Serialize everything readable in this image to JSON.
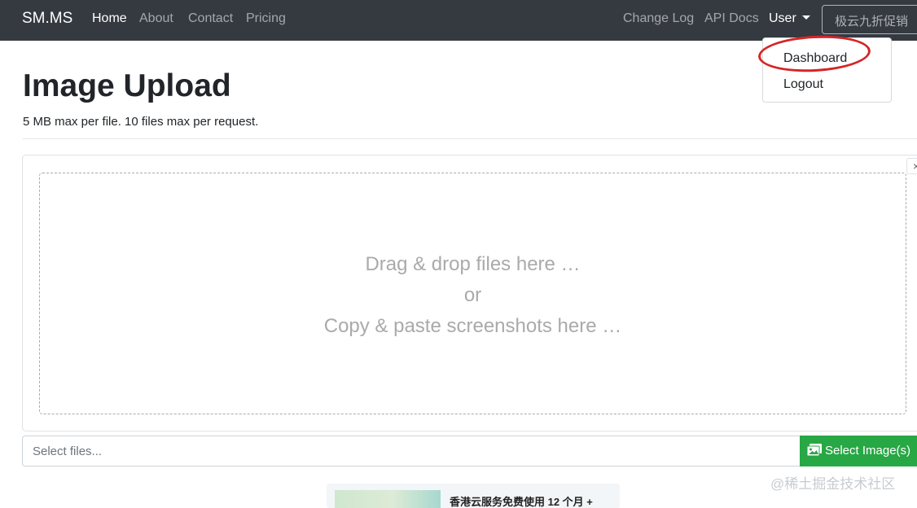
{
  "navbar": {
    "brand": "SM.MS",
    "left_links": [
      "Home",
      "About",
      "Contact",
      "Pricing"
    ],
    "active_link": "Home",
    "right_links": [
      "Change Log",
      "API Docs"
    ],
    "user_menu_label": "User",
    "promo_button": "极云九折促销"
  },
  "user_dropdown": {
    "items": [
      "Dashboard",
      "Logout"
    ],
    "highlighted_item": "Dashboard"
  },
  "page": {
    "title": "Image Upload",
    "subtitle": "5 MB max per file. 10 files max per request."
  },
  "upload": {
    "close_symbol": "×",
    "dropzone_lines": [
      "Drag & drop files here …",
      "or",
      "Copy & paste screenshots here …"
    ],
    "file_input_placeholder": "Select files...",
    "select_button": "Select Image(s)"
  },
  "ad": {
    "text": "香港云服务免费使用 12 个月 +"
  },
  "watermark": "@稀土掘金技术社区",
  "colors": {
    "navbar_bg": "#343a40",
    "select_button_bg": "#28a745",
    "annotation": "#d42626",
    "dropzone_text": "#aaaaaa"
  },
  "icons": {
    "user_menu": "caret-down-icon",
    "select_button": "images-icon",
    "close": "close-icon"
  }
}
